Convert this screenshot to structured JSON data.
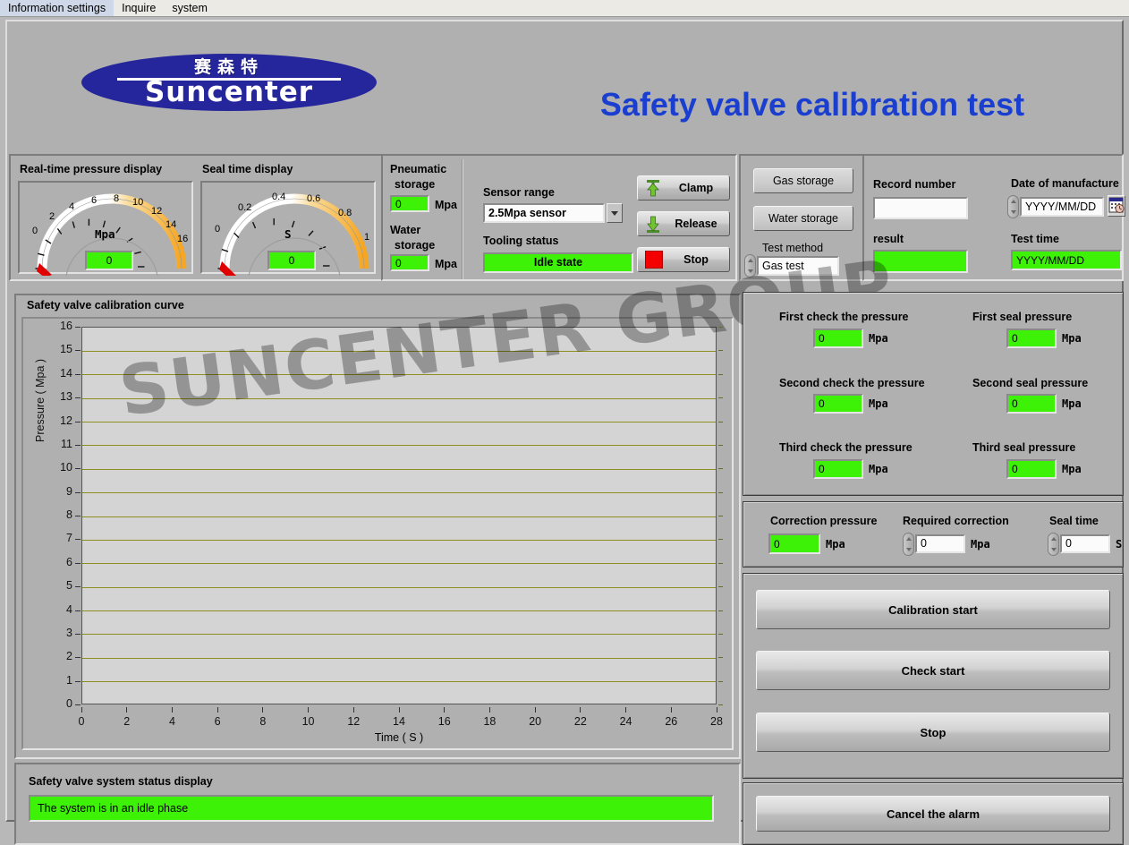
{
  "menu": {
    "items": [
      "Information settings",
      "Inquire",
      "system"
    ]
  },
  "header": {
    "logo_cn": "赛森特",
    "logo_en": "Suncenter",
    "title": "Safety valve calibration test"
  },
  "gauges": {
    "pressure": {
      "label": "Real-time pressure display",
      "unit": "Mpa",
      "value": "0",
      "ticks": [
        "0",
        "2",
        "4",
        "6",
        "8",
        "10",
        "12",
        "14",
        "16"
      ],
      "min": 0,
      "max": 16
    },
    "seal": {
      "label": "Seal time display",
      "unit": "S",
      "value": "0",
      "ticks": [
        "0",
        "0.2",
        "0.4",
        "0.6",
        "0.8",
        "1"
      ],
      "min": 0,
      "max": 1
    }
  },
  "storage": {
    "pneumatic_label": "Pneumatic\nstorage",
    "pneumatic_label_l1": "Pneumatic",
    "pneumatic_label_l2": "storage",
    "pneumatic_value": "0",
    "pneumatic_unit": "Mpa",
    "water_label_l1": "Water",
    "water_label_l2": "storage",
    "water_value": "0",
    "water_unit": "Mpa"
  },
  "sensor": {
    "range_label": "Sensor range",
    "range_value": "2.5Mpa sensor",
    "tooling_label": "Tooling status",
    "tooling_value": "Idle state",
    "clamp_label": "Clamp",
    "release_label": "Release",
    "stop_label": "Stop"
  },
  "storagebtns": {
    "gas_storage": "Gas storage",
    "water_storage": "Water storage",
    "test_method_label": "Test method",
    "test_method_value": "Gas test"
  },
  "record": {
    "record_number_label": "Record number",
    "record_number_value": "",
    "result_label": "result",
    "result_value": "",
    "date_label": "Date of manufacture",
    "date_value": "YYYY/MM/DD",
    "test_time_label": "Test time",
    "test_time_value": "YYYY/MM/DD"
  },
  "pressures": {
    "rows": [
      {
        "label": "First check the pressure",
        "value": "0",
        "unit": "Mpa"
      },
      {
        "label": "Second check the pressure",
        "value": "0",
        "unit": "Mpa"
      },
      {
        "label": "Third check the pressure",
        "value": "0",
        "unit": "Mpa"
      }
    ],
    "seal_rows": [
      {
        "label": "First seal pressure",
        "value": "0",
        "unit": "Mpa"
      },
      {
        "label": "Second seal pressure",
        "value": "0",
        "unit": "Mpa"
      },
      {
        "label": "Third seal pressure",
        "value": "0",
        "unit": "Mpa"
      }
    ]
  },
  "correction": {
    "correction_pressure_label": "Correction pressure",
    "correction_pressure_value": "0",
    "correction_pressure_unit": "Mpa",
    "required_correction_label": "Required correction",
    "required_correction_value": "0",
    "required_correction_unit": "Mpa",
    "seal_time_label": "Seal time",
    "seal_time_value": "0",
    "seal_time_unit": "S"
  },
  "actions": {
    "calibration_start": "Calibration start",
    "check_start": "Check start",
    "stop": "Stop",
    "cancel_alarm": "Cancel the alarm"
  },
  "status": {
    "label": "Safety valve system status display",
    "message": "The system is in an idle phase"
  },
  "chart_data": {
    "type": "line",
    "title": "Safety valve calibration curve",
    "watermark": "SUNCENTER GROUP",
    "xlabel": "Time ( S )",
    "ylabel": "Pressure ( Mpa )",
    "xlim": [
      0,
      28
    ],
    "ylim": [
      0,
      16
    ],
    "xticks": [
      0,
      2,
      4,
      6,
      8,
      10,
      12,
      14,
      16,
      18,
      20,
      22,
      24,
      26,
      28
    ],
    "yticks": [
      0,
      1,
      2,
      3,
      4,
      5,
      6,
      7,
      8,
      9,
      10,
      11,
      12,
      13,
      14,
      15,
      16
    ],
    "grid": true,
    "grid_color": "#8f8f21",
    "series": [
      {
        "name": "Pressure",
        "x": [],
        "y": []
      }
    ]
  },
  "colors": {
    "accent_blue": "#1a3fd0",
    "logo_blue": "#26269c",
    "indicator_green": "#3df207",
    "panel_gray": "#b0b0b0",
    "gauge_amber": "#f5a623",
    "needle_red": "#e00000"
  }
}
